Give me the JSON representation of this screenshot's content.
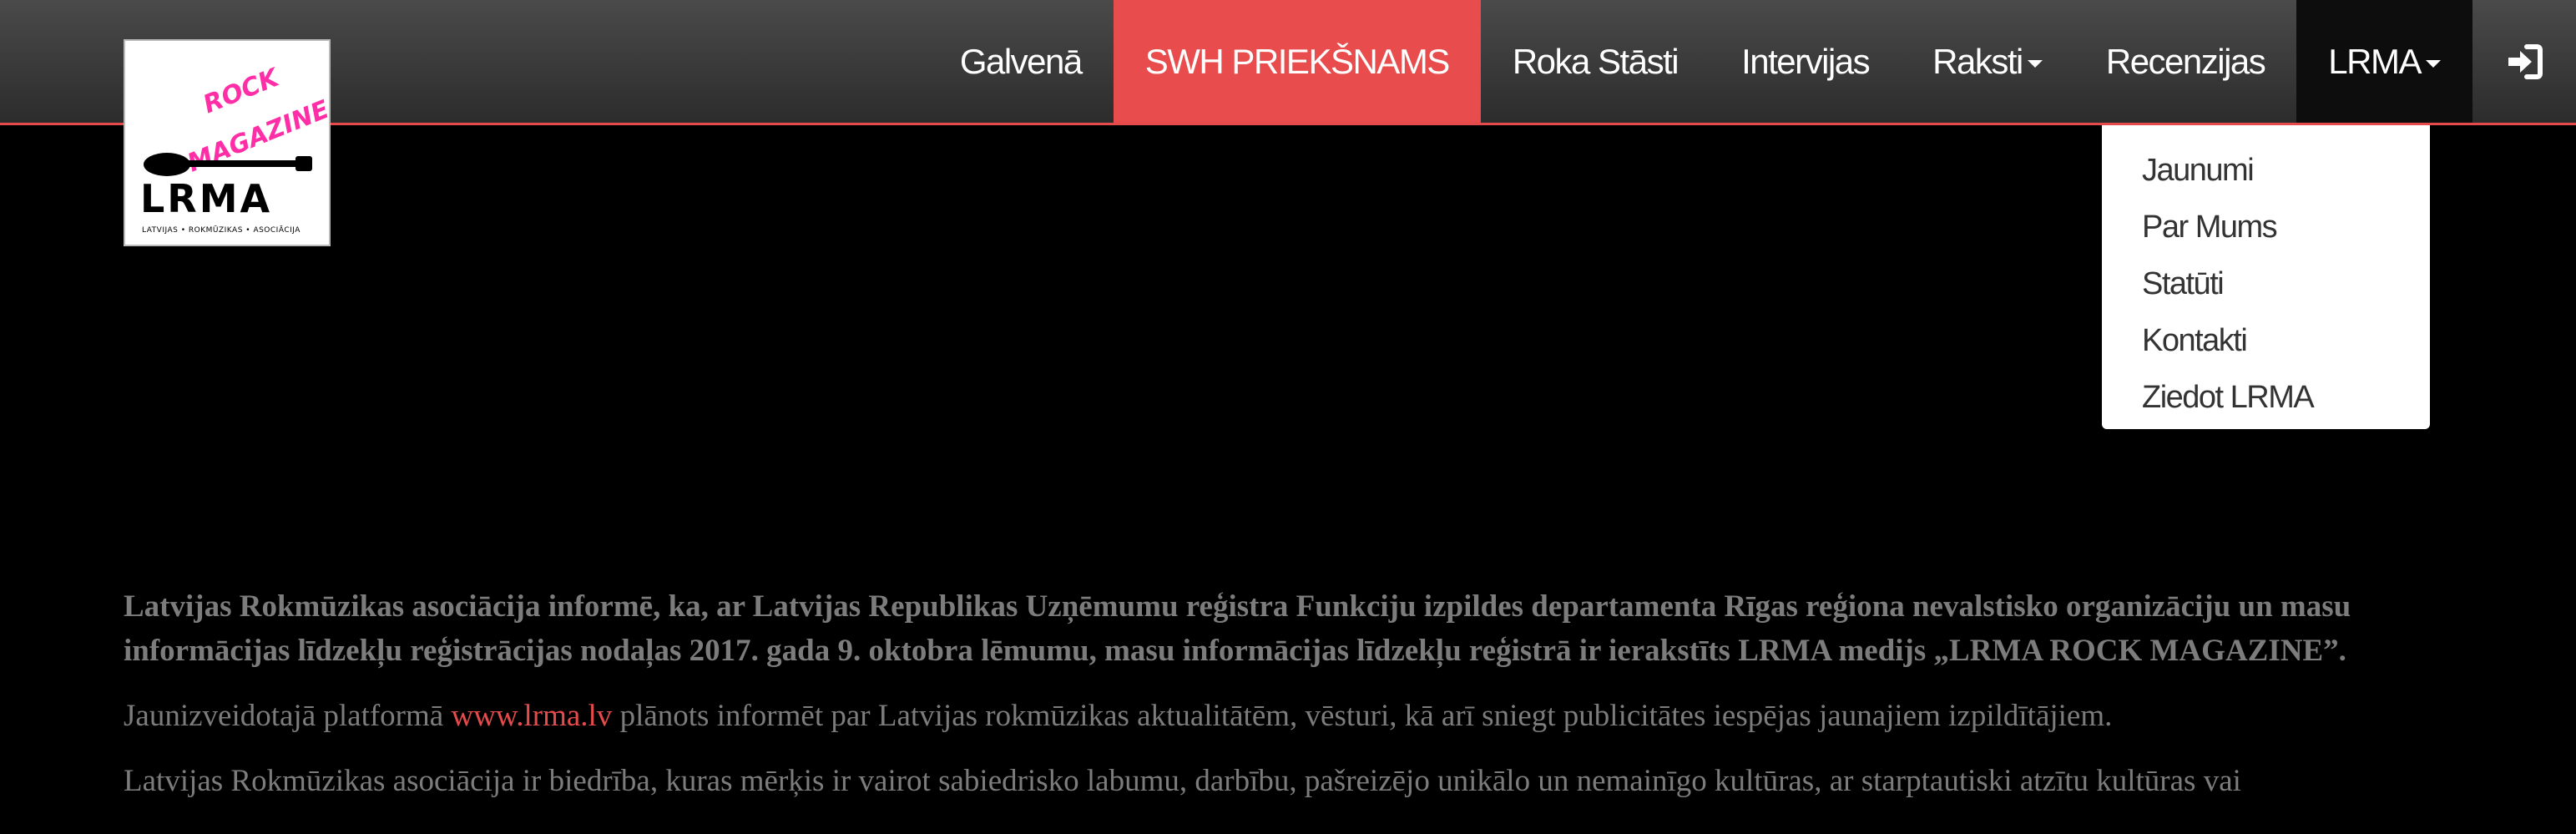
{
  "logo": {
    "rock": "ROCK",
    "magazine": "MAGAZINE",
    "name": "LRMA",
    "tagline": "LATVIJAS • ROKMŪZIKAS • ASOCIĀCIJA",
    "accent_color": "#ff2ea6"
  },
  "nav": {
    "items": [
      {
        "label": "Galvenā"
      },
      {
        "label": "SWH PRIEKŠNAMS",
        "active": true
      },
      {
        "label": "Roka Stāsti"
      },
      {
        "label": "Intervijas"
      },
      {
        "label": "Raksti",
        "dropdown": true
      },
      {
        "label": "Recenzijas"
      },
      {
        "label": "LRMA",
        "dropdown": true,
        "open": true
      }
    ],
    "login_icon": "sign-in-icon",
    "active_color": "#e84c4c"
  },
  "dropdown": {
    "items": [
      "Jaunumi",
      "Par Mums",
      "Statūti",
      "Kontakti",
      "Ziedot LRMA"
    ]
  },
  "article": {
    "lead": "Latvijas Rokmūzikas asociācija informē, ka, ar Latvijas Republikas Uzņēmumu reģistra Funkciju izpildes departamenta Rīgas reģiona nevalstisko organizāciju un masu informācijas līdzekļu reģistrācijas nodaļas 2017. gada 9. oktobra lēmumu, masu informācijas līdzekļu reģistrā ir ierakstīts LRMA medijs „LRMA ROCK MAGAZINE”.",
    "p1_before": "Jaunizveidotajā platformā ",
    "p1_link": "www.lrma.lv",
    "p1_after": " plānots informēt par Latvijas rokmūzikas aktualitātēm, vēsturi, kā arī sniegt publicitātes iespējas jaunajiem izpildītājiem.",
    "p2": "Latvijas Rokmūzikas asociācija ir biedrība, kuras mērķis ir vairot sabiedrisko labumu, darbību, pašreizējo unikālo un nemainīgo kultūras, ar starptautiski atzītu kultūras vai",
    "link_color": "#e64b4b"
  }
}
